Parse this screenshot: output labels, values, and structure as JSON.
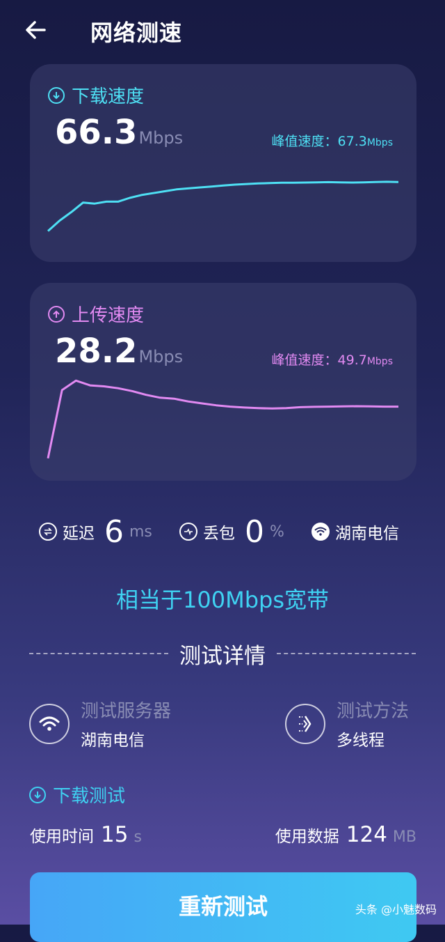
{
  "header": {
    "title": "网络测速"
  },
  "download": {
    "title": "下载速度",
    "speed": "66.3",
    "unit": "Mbps",
    "peak_label": "峰值速度：",
    "peak_value": "67.3",
    "peak_unit": "Mbps",
    "color": "#4ee0f4",
    "curve": [
      7.5,
      13,
      17.5,
      22.5,
      22,
      23,
      23,
      25,
      26.5,
      27.5,
      28.5,
      29.5,
      30,
      30.5,
      31,
      31.5,
      32,
      32.3,
      32.6,
      32.8,
      33,
      33,
      33.1,
      33.2,
      33.3,
      33.2,
      33.1,
      33.2,
      33.4,
      33.5,
      33.4
    ]
  },
  "upload": {
    "title": "上传速度",
    "speed": "28.2",
    "unit": "Mbps",
    "peak_label": "峰值速度：",
    "peak_value": "49.7",
    "peak_unit": "Mbps",
    "color": "#e28af2",
    "curve": [
      3,
      39,
      44,
      41.5,
      41,
      40,
      38.5,
      36.5,
      35,
      34.5,
      33,
      32,
      31,
      30.3,
      29.8,
      29.5,
      29.3,
      29.5,
      30,
      30.2,
      30.3,
      30.4,
      30.5,
      30.4,
      30.3,
      30.3
    ]
  },
  "stats": {
    "latency_label": "延迟",
    "latency_value": "6",
    "latency_unit": "ms",
    "loss_label": "丢包",
    "loss_value": "0",
    "loss_unit": "%",
    "isp": "湖南电信"
  },
  "equivalent": "相当于100Mbps宽带",
  "details": {
    "section_title": "测试详情",
    "server_label": "测试服务器",
    "server_value": "湖南电信",
    "method_label": "测试方法",
    "method_value": "多线程",
    "download_test_title": "下载测试",
    "time_label": "使用时间",
    "time_value": "15",
    "time_unit": "s",
    "data_label": "使用数据",
    "data_value": "124",
    "data_unit": "MB"
  },
  "retest_label": "重新测试",
  "watermark": "头条 @小魅数码",
  "icons": {
    "back": "arrow-left-icon",
    "download": "download-circle-icon",
    "upload": "upload-circle-icon",
    "latency": "latency-icon",
    "loss": "packet-loss-icon",
    "wifi": "wifi-icon",
    "method": "multithread-icon"
  }
}
